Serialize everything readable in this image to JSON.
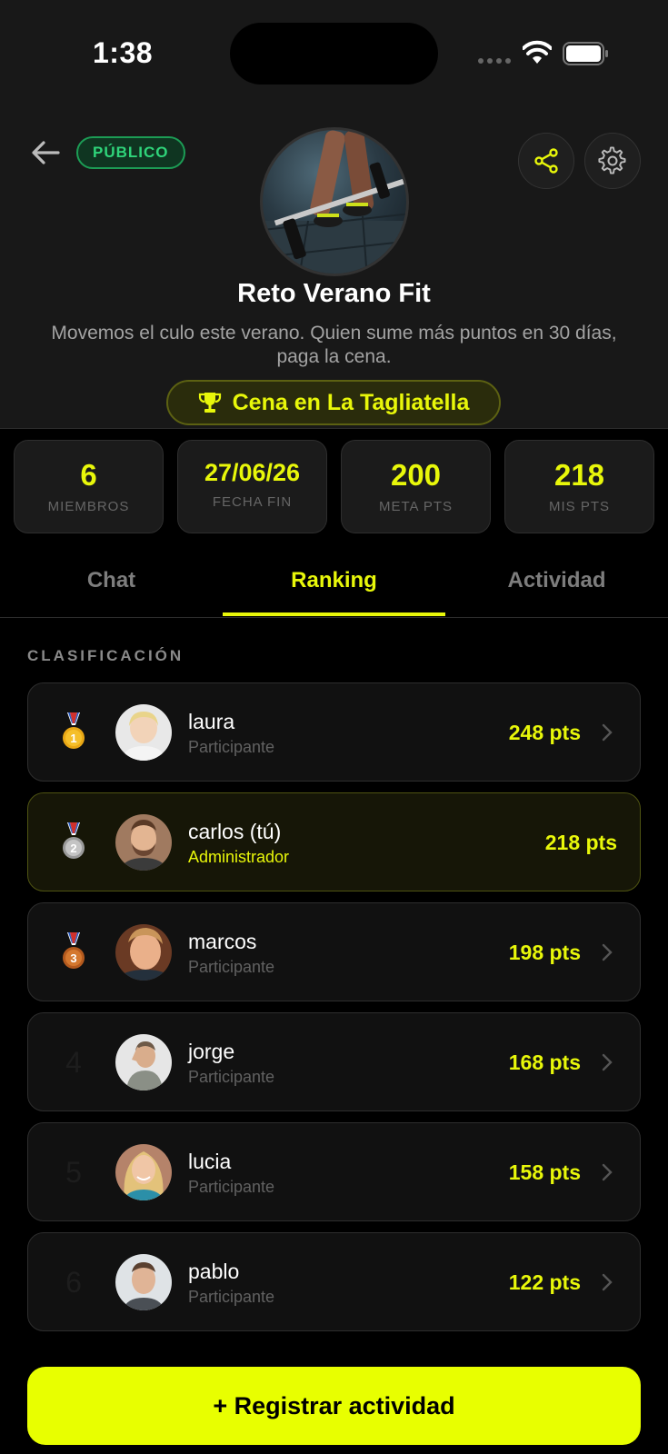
{
  "status_bar": {
    "time": "1:38"
  },
  "header": {
    "badge": "PÚBLICO",
    "title": "Reto Verano Fit",
    "description": "Movemos el culo este verano. Quien sume más puntos en 30 días, paga la cena.",
    "prize": "Cena en La Tagliatella"
  },
  "stats": [
    {
      "value": "6",
      "label": "MIEMBROS"
    },
    {
      "value": "27/06/26",
      "label": "FECHA FIN"
    },
    {
      "value": "200",
      "label": "META PTS"
    },
    {
      "value": "218",
      "label": "MIS PTS"
    }
  ],
  "tabs": [
    {
      "label": "Chat",
      "active": false
    },
    {
      "label": "Ranking",
      "active": true
    },
    {
      "label": "Actividad",
      "active": false
    }
  ],
  "section_label": "CLASIFICACIÓN",
  "ranking": [
    {
      "position": "1",
      "medal": "gold",
      "name": "laura",
      "role": "Participante",
      "points": "248 pts"
    },
    {
      "position": "2",
      "medal": "silver",
      "name": "carlos (tú)",
      "role": "Administrador",
      "points": "218 pts"
    },
    {
      "position": "3",
      "medal": "bronze",
      "name": "marcos",
      "role": "Participante",
      "points": "198 pts"
    },
    {
      "position": "4",
      "medal": "",
      "name": "jorge",
      "role": "Participante",
      "points": "168 pts"
    },
    {
      "position": "5",
      "medal": "",
      "name": "lucia",
      "role": "Participante",
      "points": "158 pts"
    },
    {
      "position": "6",
      "medal": "",
      "name": "pablo",
      "role": "Participante",
      "points": "122 pts"
    }
  ],
  "cta_label": "+ Registrar actividad",
  "colors": {
    "accent": "#e8f70a",
    "background": "#000000",
    "public_green": "#2fd47a"
  },
  "icons": [
    "back-arrow-icon",
    "share-icon",
    "gear-icon",
    "trophy-icon",
    "chevron-right-icon",
    "medal-icon",
    "wifi-icon",
    "battery-icon"
  ]
}
